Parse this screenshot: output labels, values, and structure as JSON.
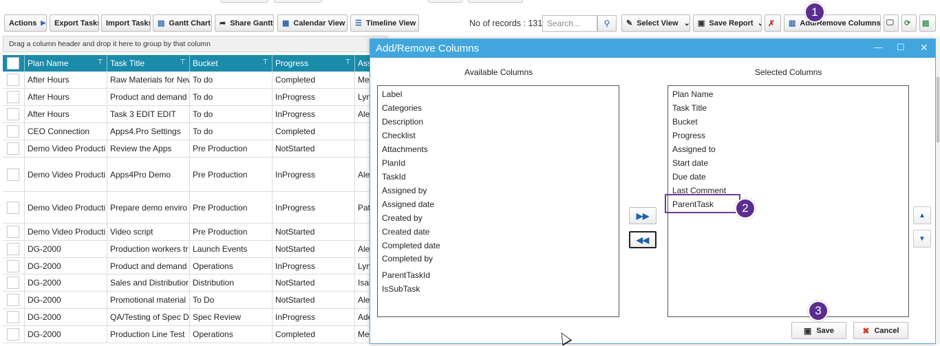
{
  "toolbar": {
    "actions": "Actions",
    "export_tasks": "Export Tasks",
    "import_tasks": "Import Tasks",
    "gantt_chart": "Gantt Chart",
    "share_gantt": "Share Gantt",
    "calendar_view": "Calendar View",
    "timeline_view": "Timeline View",
    "records_label": "No of records : 131",
    "search_placeholder": "Search...",
    "select_view": "Select View",
    "save_report": "Save Report",
    "add_remove_columns": "Add/Remove Columns.."
  },
  "grid": {
    "group_hint": "Drag a column header and drop it here to group by that column",
    "columns": [
      "Plan Name",
      "Task Title",
      "Bucket",
      "Progress",
      "Ass"
    ],
    "rows": [
      [
        "After Hours",
        "Raw Materials for New",
        "To do",
        "Completed",
        "Me"
      ],
      [
        "After Hours",
        "Product and demand",
        "To do",
        "InProgress",
        "Lyn"
      ],
      [
        "After Hours",
        "Task 3 EDIT EDIT",
        "To do",
        "InProgress",
        "Ale"
      ],
      [
        "CEO Connection",
        "Apps4.Pro Settings",
        "To do",
        "Completed",
        ""
      ],
      [
        "Demo Video Producti",
        "Review the Apps",
        "Pre Production",
        "NotStarted",
        ""
      ],
      [
        "Demo Video Producti",
        "Apps4Pro Demo",
        "Pre Production",
        "InProgress",
        "Ale"
      ],
      [
        "Demo Video Producti",
        "Prepare demo enviro",
        "Pre Production",
        "InProgress",
        "Pat"
      ],
      [
        "Demo Video Producti",
        "Video script",
        "Pre Production",
        "NotStarted",
        ""
      ],
      [
        "DG-2000",
        "Production workers tr",
        "Launch Events",
        "NotStarted",
        "Ale"
      ],
      [
        "DG-2000",
        "Product and demand",
        "Operations",
        "InProgress",
        "Lyn"
      ],
      [
        "DG-2000",
        "Sales and Distributior",
        "Distribution",
        "NotStarted",
        "Isai"
      ],
      [
        "DG-2000",
        "Promotional material",
        "To Do",
        "NotStarted",
        "Ale"
      ],
      [
        "DG-2000",
        "QA/Testing of Spec D",
        "Spec Review",
        "InProgress",
        "Ade"
      ],
      [
        "DG-2000",
        "Production Line Test",
        "Operations",
        "Completed",
        "Me"
      ]
    ]
  },
  "dialog": {
    "title": "Add/Remove Columns",
    "available_caption": "Available Columns",
    "selected_caption": "Selected Columns",
    "available": [
      "Label",
      "Categories",
      "Description",
      "Checklist",
      "Attachments",
      "PlanId",
      "TaskId",
      "Assigned by",
      "Assigned date",
      "Created by",
      "Created date",
      "Completed date",
      "Completed by",
      "ParentTaskId",
      "IsSubTask"
    ],
    "selected": [
      "Plan Name",
      "Task Title",
      "Bucket",
      "Progress",
      "Assigned to",
      "Start date",
      "Due date",
      "Last Comment",
      "ParentTask"
    ],
    "save": "Save",
    "cancel": "Cancel"
  },
  "callouts": [
    "1",
    "2",
    "3"
  ],
  "colors": {
    "header_teal": "#1b8baa",
    "dialog_blue": "#41a6dd",
    "callout_purple": "#5c2d8f"
  }
}
